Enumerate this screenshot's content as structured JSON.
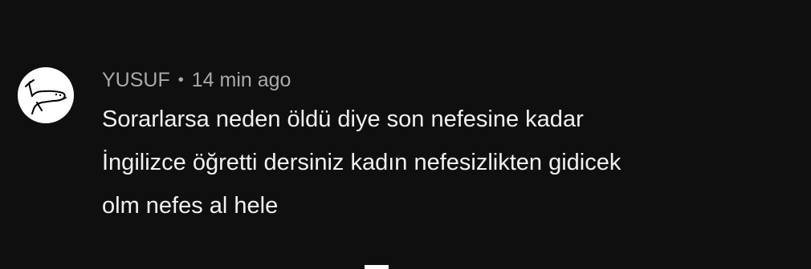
{
  "comment": {
    "author": "YUSUF",
    "separator": "•",
    "timestamp": "14 min ago",
    "text": "Sorarlarsa neden öldü diye son nefesine kadar\nİngilizce öğretti dersiniz kadın nefesizlikten gidicek\nolm nefes al hele",
    "avatar_icon": "stick-figure-doodle-icon"
  },
  "colors": {
    "background": "#0f0f0f",
    "meta_text": "#aaaaaa",
    "body_text": "#f1f1f1",
    "avatar_bg": "#ffffff"
  }
}
